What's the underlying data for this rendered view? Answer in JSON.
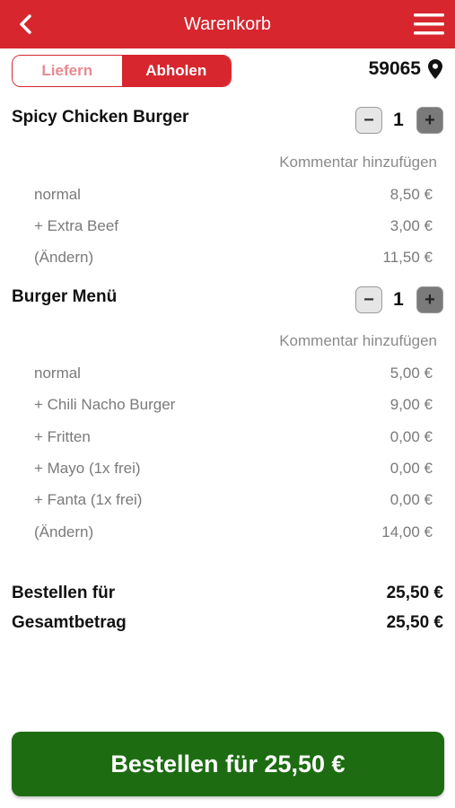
{
  "header": {
    "title": "Warenkorb"
  },
  "mode_toggle": {
    "delivery_label": "Liefern",
    "pickup_label": "Abholen",
    "selected": "Abholen"
  },
  "location": {
    "postcode": "59065"
  },
  "items": [
    {
      "name": "Spicy Chicken Burger",
      "quantity": "1",
      "comment_label": "Kommentar hinzufügen",
      "lines": [
        {
          "label": "normal",
          "price": "8,50 €"
        },
        {
          "label": "+ Extra Beef",
          "price": "3,00 €"
        },
        {
          "label": "(Ändern)",
          "price": "11,50 €"
        }
      ]
    },
    {
      "name": "Burger Menü",
      "quantity": "1",
      "comment_label": "Kommentar hinzufügen",
      "lines": [
        {
          "label": "normal",
          "price": "5,00 €"
        },
        {
          "label": "+ Chili Nacho Burger",
          "price": "9,00 €"
        },
        {
          "label": "+ Fritten",
          "price": "0,00 €"
        },
        {
          "label": "+ Mayo (1x frei)",
          "price": "0,00 €"
        },
        {
          "label": "+ Fanta (1x frei)",
          "price": "0,00 €"
        },
        {
          "label": "(Ändern)",
          "price": "14,00 €"
        }
      ]
    }
  ],
  "totals": {
    "order_label": "Bestellen für",
    "order_value": "25,50 €",
    "total_label": "Gesamtbetrag",
    "total_value": "25,50 €"
  },
  "order_button": {
    "label": "Bestellen für 25,50 €"
  },
  "icons": {
    "back": "chevron-left-icon",
    "menu": "hamburger-menu-icon",
    "location": "map-pin-icon",
    "minus": "minus-icon",
    "plus": "plus-icon"
  },
  "colors": {
    "brand_red": "#d7262e",
    "order_green": "#1d6c12",
    "muted_text": "#7a7a7a"
  }
}
